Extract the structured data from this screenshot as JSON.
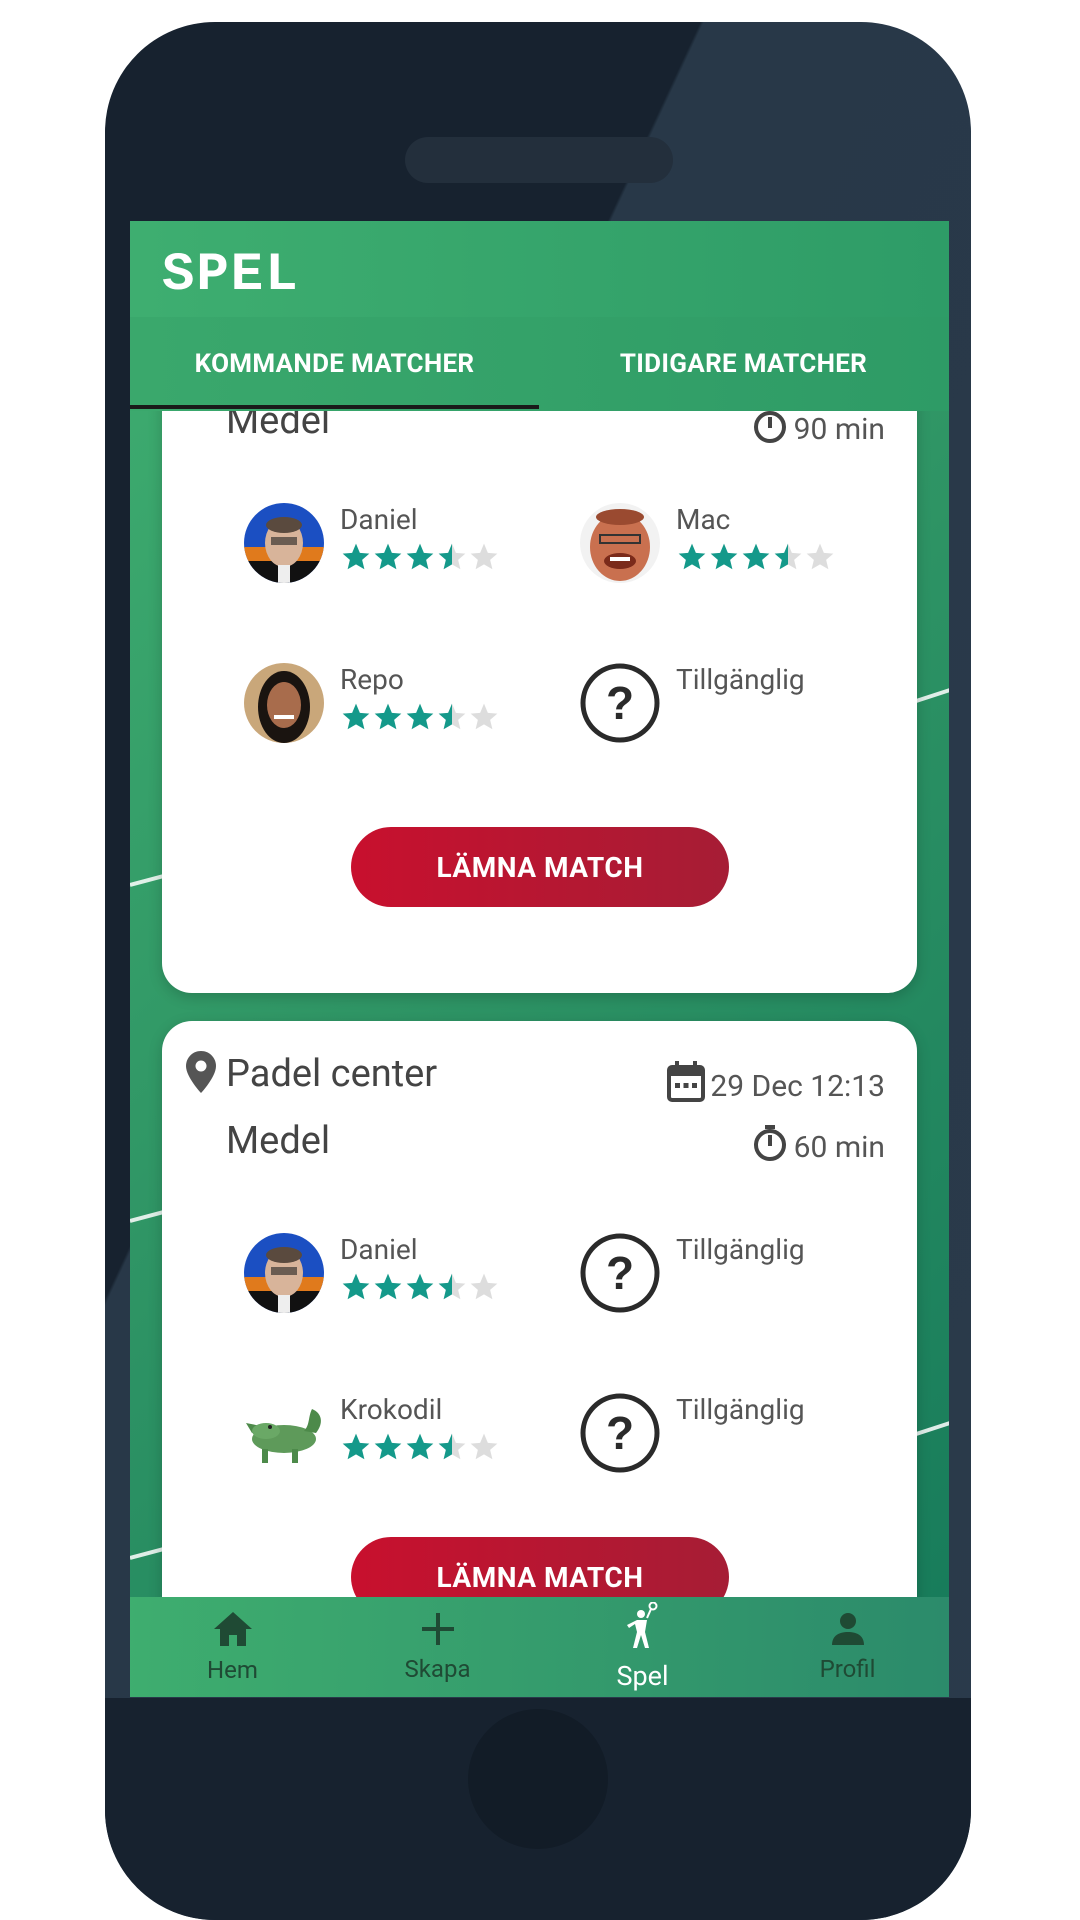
{
  "app": {
    "title": "SPEL"
  },
  "tabs": [
    {
      "label": "KOMMANDE MATCHER",
      "active": true
    },
    {
      "label": "TIDIGARE MATCHER",
      "active": false
    }
  ],
  "matches": [
    {
      "location": "",
      "level": "Medel",
      "date": "",
      "duration": "90 min",
      "players": [
        {
          "name": "Daniel",
          "rating": 3.5,
          "avatar": "daniel-photo"
        },
        {
          "name": "Mac",
          "rating": 3.5,
          "avatar": "mac-photo"
        },
        {
          "name": "Repo",
          "rating": 3.5,
          "avatar": "repo-photo"
        },
        {
          "name": "Tillgänglig",
          "rating": null,
          "avatar": "question-icon"
        }
      ],
      "leave_label": "LÄMNA MATCH"
    },
    {
      "location": "Padel center",
      "level": "Medel",
      "date": "29 Dec 12:13",
      "duration": "60 min",
      "players": [
        {
          "name": "Daniel",
          "rating": 3.5,
          "avatar": "daniel-photo"
        },
        {
          "name": "Tillgänglig",
          "rating": null,
          "avatar": "question-icon"
        },
        {
          "name": "Krokodil",
          "rating": 3.5,
          "avatar": "crocodile-image"
        },
        {
          "name": "Tillgänglig",
          "rating": null,
          "avatar": "question-icon"
        }
      ],
      "leave_label": "LÄMNA MATCH"
    }
  ],
  "nav": [
    {
      "label": "Hem",
      "icon": "home-icon",
      "active": false
    },
    {
      "label": "Skapa",
      "icon": "plus-icon",
      "active": false
    },
    {
      "label": "Spel",
      "icon": "padel-player-icon",
      "active": true
    },
    {
      "label": "Profil",
      "icon": "person-icon",
      "active": false
    }
  ],
  "colors": {
    "primary_green": "#3eae70",
    "star_teal": "#14998a",
    "star_empty": "#dddddd",
    "leave_red": "#c8102e",
    "phone_frame": "#17222f"
  }
}
